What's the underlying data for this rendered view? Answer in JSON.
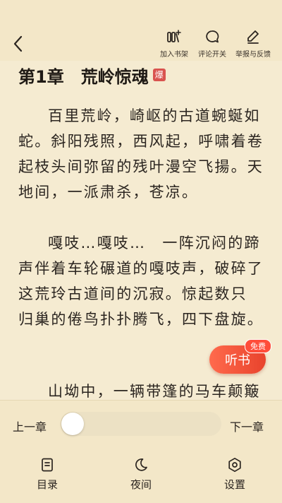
{
  "topbar": {
    "actions": [
      {
        "label": "加入书架",
        "icon": "bookshelf-add-icon"
      },
      {
        "label": "评论开关",
        "icon": "comment-icon"
      },
      {
        "label": "举报与反馈",
        "icon": "edit-report-icon"
      }
    ]
  },
  "chapter": {
    "title": "第1章　荒岭惊魂",
    "badge": "爆",
    "paragraphs": [
      "百里荒岭，崎岖的古道蜿蜒如蛇。斜阳残照，西风起，呼啸着卷起枝头间弥留的残叶漫空飞揚。天地间，一派肃杀，苍凉。",
      "嘎吱…嘎吱…　一阵沉闷的蹄声伴着车轮碾道的嘎吱声，破碎了这荒玲古道间的沉寂。惊起数只　归巢的倦鸟扑扑腾飞，四下盘旋。",
      "山坳中，一辆带篷的马车颠簸"
    ]
  },
  "listen": {
    "label": "听书",
    "tag": "免费"
  },
  "progress": {
    "prev_label": "上一章",
    "next_label": "下一章",
    "value": 0
  },
  "nav": [
    {
      "label": "目录",
      "icon": "catalog-icon"
    },
    {
      "label": "夜间",
      "icon": "night-mode-icon"
    },
    {
      "label": "设置",
      "icon": "settings-icon"
    }
  ],
  "colors": {
    "accent": "#e8432c",
    "background": "#f6ecd2"
  }
}
